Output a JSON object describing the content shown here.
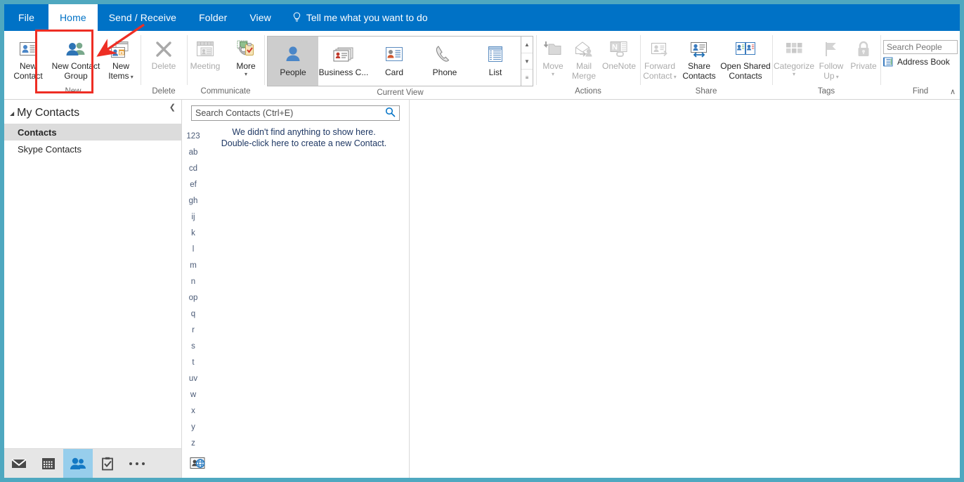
{
  "window": {
    "border_color": "#4FA8C0",
    "ribbon_blue": "#0072C6"
  },
  "tabs": [
    {
      "label": "File",
      "active": false
    },
    {
      "label": "Home",
      "active": true
    },
    {
      "label": "Send / Receive",
      "active": false
    },
    {
      "label": "Folder",
      "active": false
    },
    {
      "label": "View",
      "active": false
    }
  ],
  "tellme": {
    "label": "Tell me what you want to do",
    "icon": "lightbulb-icon"
  },
  "ribbon": {
    "collapse_label": "∧",
    "groups": [
      {
        "name": "New",
        "label": "New",
        "buttons": [
          {
            "label_line1": "New",
            "label_line2": "Contact",
            "icon": "new-contact-icon",
            "disabled": false,
            "dropdown": false
          },
          {
            "label_line1": "New Contact",
            "label_line2": "Group",
            "icon": "new-contact-group-icon",
            "disabled": false,
            "dropdown": false
          },
          {
            "label_line1": "New",
            "label_line2": "Items",
            "icon": "new-items-icon",
            "disabled": false,
            "dropdown": true
          }
        ]
      },
      {
        "name": "Delete",
        "label": "Delete",
        "buttons": [
          {
            "label_line1": "Delete",
            "label_line2": "",
            "icon": "delete-x-icon",
            "disabled": true,
            "dropdown": false
          }
        ]
      },
      {
        "name": "Communicate",
        "label": "Communicate",
        "buttons": [
          {
            "label_line1": "Meeting",
            "label_line2": "",
            "icon": "meeting-icon",
            "disabled": true,
            "dropdown": false
          },
          {
            "label_line1": "More",
            "label_line2": "",
            "icon": "more-communicate-icon",
            "disabled": false,
            "dropdown": true
          }
        ]
      },
      {
        "name": "Current View",
        "label": "Current View",
        "gallery": [
          {
            "label": "People",
            "icon": "people-view-icon",
            "selected": true
          },
          {
            "label": "Business C...",
            "icon": "business-card-view-icon",
            "selected": false
          },
          {
            "label": "Card",
            "icon": "card-view-icon",
            "selected": false
          },
          {
            "label": "Phone",
            "icon": "phone-view-icon",
            "selected": false
          },
          {
            "label": "List",
            "icon": "list-view-icon",
            "selected": false
          }
        ],
        "scroll": [
          "▲",
          "▼",
          "≡"
        ]
      },
      {
        "name": "Actions",
        "label": "Actions",
        "buttons": [
          {
            "label_line1": "Move",
            "label_line2": "",
            "icon": "move-folder-icon",
            "disabled": true,
            "dropdown": true
          },
          {
            "label_line1": "Mail",
            "label_line2": "Merge",
            "icon": "mail-merge-icon",
            "disabled": true,
            "dropdown": false
          },
          {
            "label_line1": "OneNote",
            "label_line2": "",
            "icon": "onenote-icon",
            "disabled": true,
            "dropdown": false
          }
        ]
      },
      {
        "name": "Share",
        "label": "Share",
        "buttons": [
          {
            "label_line1": "Forward",
            "label_line2": "Contact",
            "icon": "forward-contact-icon",
            "disabled": true,
            "dropdown": true
          },
          {
            "label_line1": "Share",
            "label_line2": "Contacts",
            "icon": "share-contacts-icon",
            "disabled": false,
            "dropdown": false
          },
          {
            "label_line1": "Open Shared",
            "label_line2": "Contacts",
            "icon": "open-shared-contacts-icon",
            "disabled": false,
            "dropdown": false
          }
        ]
      },
      {
        "name": "Tags",
        "label": "Tags",
        "buttons": [
          {
            "label_line1": "Categorize",
            "label_line2": "",
            "icon": "categorize-icon",
            "disabled": true,
            "dropdown": true
          },
          {
            "label_line1": "Follow",
            "label_line2": "Up",
            "icon": "follow-up-flag-icon",
            "disabled": true,
            "dropdown": true
          },
          {
            "label_line1": "Private",
            "label_line2": "",
            "icon": "private-lock-icon",
            "disabled": true,
            "dropdown": false
          }
        ]
      },
      {
        "name": "Find",
        "label": "Find",
        "search_people_placeholder": "Search People",
        "address_book_label": "Address Book",
        "address_book_icon": "address-book-icon"
      }
    ]
  },
  "folder_pane": {
    "collapse_icon": "❮",
    "header": "My Contacts",
    "items": [
      {
        "label": "Contacts",
        "selected": true
      },
      {
        "label": "Skype Contacts",
        "selected": false
      }
    ],
    "nav": [
      {
        "icon": "mail-icon",
        "active": false
      },
      {
        "icon": "calendar-icon",
        "active": false
      },
      {
        "icon": "people-icon",
        "active": true
      },
      {
        "icon": "tasks-icon",
        "active": false
      },
      {
        "icon": "more-ellipsis-icon",
        "active": false
      }
    ]
  },
  "list_pane": {
    "search_placeholder": "Search Contacts (Ctrl+E)",
    "search_value": "",
    "search_icon": "magnifier-icon",
    "alpha_index": [
      "123",
      "ab",
      "cd",
      "ef",
      "gh",
      "ij",
      "k",
      "l",
      "m",
      "n",
      "op",
      "q",
      "r",
      "s",
      "t",
      "uv",
      "w",
      "x",
      "y",
      "z"
    ],
    "empty_line1": "We didn't find anything to show here.",
    "empty_line2": "Double-click here to create a new Contact.",
    "footer_icon": "contact-globe-icon"
  },
  "annotation": {
    "box_color": "#EE2E24",
    "arrow_color": "#EE2E24",
    "target": "new-contact-group-button"
  }
}
